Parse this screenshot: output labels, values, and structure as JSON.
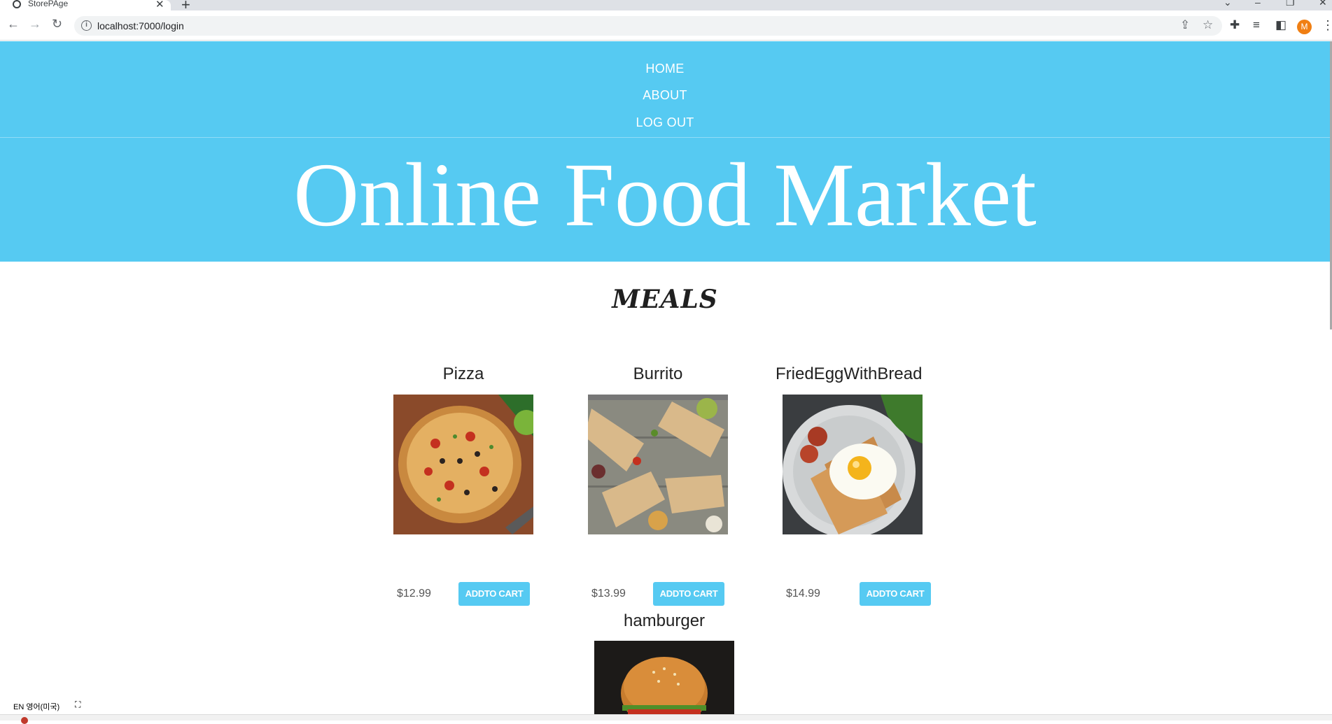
{
  "browser": {
    "tab_title": "StorePAge",
    "tab_close": "✕",
    "new_tab": "+",
    "url": "localhost:7000/login",
    "avatar_initial": "M"
  },
  "nav": {
    "items": [
      "HOME",
      "ABOUT",
      "LOG OUT"
    ]
  },
  "header": {
    "title": "Online Food Market"
  },
  "section": {
    "title": "MEALS"
  },
  "products": [
    {
      "name": "Pizza",
      "price": "$12.99",
      "button": "ADDTO CART"
    },
    {
      "name": "Burrito",
      "price": "$13.99",
      "button": "ADDTO CART"
    },
    {
      "name": "FriedEggWithBread",
      "price": "$14.99",
      "button": "ADDTO CART"
    },
    {
      "name": "hamburger"
    }
  ],
  "ime": {
    "label": "EN 영어(미국)"
  },
  "colors": {
    "header_bg": "#56caf2",
    "button_bg": "#56caf2"
  }
}
